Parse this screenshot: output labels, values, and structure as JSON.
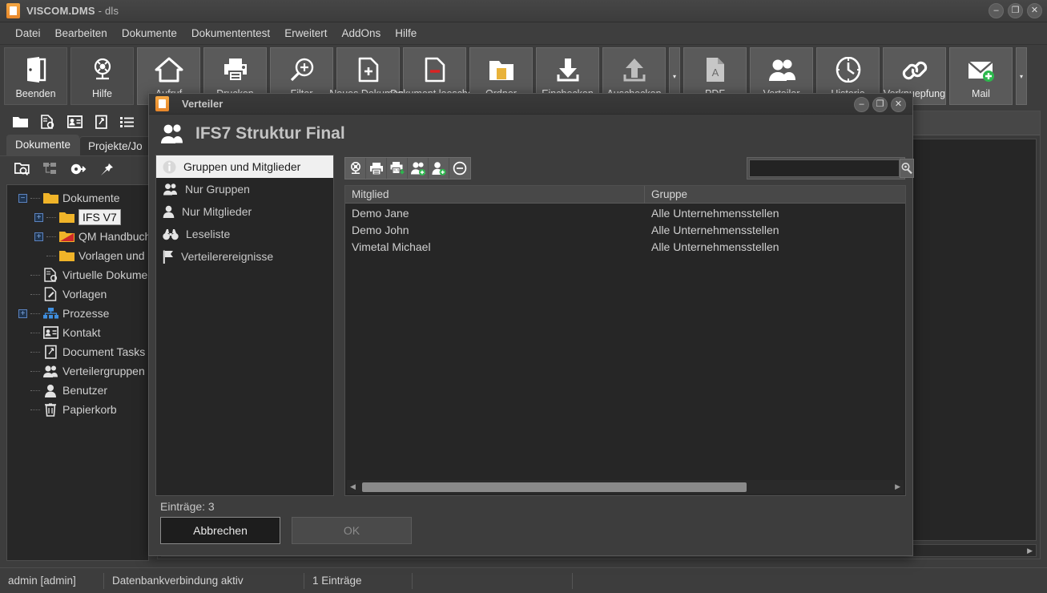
{
  "window": {
    "title": "VISCOM.DMS",
    "title_sub": "- dls",
    "app_icon": "document-icon",
    "controls": [
      {
        "name": "minimize-button",
        "glyph": "–"
      },
      {
        "name": "maximize-button",
        "glyph": "❐"
      },
      {
        "name": "close-button",
        "glyph": "✕"
      }
    ]
  },
  "menubar": {
    "items": [
      "Datei",
      "Bearbeiten",
      "Dokumente",
      "Dokumententest",
      "Erweitert",
      "AddOns",
      "Hilfe"
    ]
  },
  "ribbon": {
    "buttons": [
      {
        "label": "Beenden",
        "icon": "exit-door-icon",
        "dark": true
      },
      {
        "label": "Hilfe",
        "icon": "lifebuoy-icon",
        "dark": true
      },
      {
        "label": "Aufruf",
        "icon": "home-icon",
        "dark": false
      },
      {
        "label": "Drucken",
        "icon": "printer-icon",
        "dark": false
      },
      {
        "label": "Filter",
        "icon": "magnifier-plus-icon",
        "dark": false
      },
      {
        "label": "Neues Dokument",
        "icon": "document-add-icon",
        "dark": false
      },
      {
        "label": "Dokument loeschen",
        "icon": "document-remove-icon",
        "dark": false
      },
      {
        "label": "Ordner",
        "icon": "folder-document-icon",
        "dark": false
      },
      {
        "label": "Einchecken",
        "icon": "download-icon",
        "dark": false
      },
      {
        "label": "Auschecken",
        "icon": "upload-icon",
        "dark": false
      }
    ],
    "dropdown_glyph": "▾",
    "buttons2": [
      {
        "label": "PDF",
        "icon": "pdf-file-icon"
      },
      {
        "label": "Verteiler",
        "icon": "people-icon"
      },
      {
        "label": "Historie",
        "icon": "clock-icon"
      },
      {
        "label": "Verknuepfung",
        "icon": "link-icon"
      },
      {
        "label": "Mail",
        "icon": "mail-add-icon"
      }
    ]
  },
  "sidebar": {
    "toolbar_icons": [
      "folder-icon",
      "document-search-icon",
      "contact-card-icon",
      "clipboard-edit-icon",
      "list-icon"
    ],
    "tabs": [
      {
        "label": "Dokumente",
        "active": true
      },
      {
        "label": "Projekte/Jo",
        "active": false
      }
    ],
    "tree_toolbar_icons": [
      "folder-search-icon",
      "tree-structure-icon",
      "logout-arrow-icon",
      "pin-icon"
    ],
    "tree": [
      {
        "label": "Dokumente",
        "icon": "folder-icon",
        "depth": 0,
        "expander": "minus",
        "selected": false
      },
      {
        "label": "IFS V7",
        "icon": "folder-icon",
        "depth": 1,
        "expander": "plus",
        "selected": true
      },
      {
        "label": "QM Handbuch",
        "icon": "folder-red-icon",
        "depth": 1,
        "expander": "plus",
        "selected": false
      },
      {
        "label": "Vorlagen und",
        "icon": "folder-icon",
        "depth": 1,
        "expander": "none",
        "selected": false
      },
      {
        "label": "Virtuelle Dokume",
        "icon": "document-search-icon",
        "depth": 0,
        "expander": "none",
        "selected": false
      },
      {
        "label": "Vorlagen",
        "icon": "template-icon",
        "depth": 0,
        "expander": "none",
        "selected": false
      },
      {
        "label": "Prozesse",
        "icon": "process-tree-icon",
        "depth": 0,
        "expander": "plus",
        "selected": false
      },
      {
        "label": "Kontakt",
        "icon": "contact-card-icon",
        "depth": 0,
        "expander": "none",
        "selected": false
      },
      {
        "label": "Document Tasks",
        "icon": "clipboard-edit-icon",
        "depth": 0,
        "expander": "none",
        "selected": false
      },
      {
        "label": "Verteilergruppen",
        "icon": "people-icon",
        "depth": 0,
        "expander": "none",
        "selected": false
      },
      {
        "label": "Benutzer",
        "icon": "user-icon",
        "depth": 0,
        "expander": "none",
        "selected": false
      },
      {
        "label": "Papierkorb",
        "icon": "trash-icon",
        "depth": 0,
        "expander": "none",
        "selected": false
      }
    ]
  },
  "statusbar": {
    "user": "admin [admin]",
    "connection": "Datenbankverbindung aktiv",
    "entries": "1 Einträge",
    "extra": ""
  },
  "dialog": {
    "titlebar": {
      "icon": "document-icon",
      "title": "Verteiler",
      "controls": [
        {
          "name": "dialog-minimize-button",
          "glyph": "–"
        },
        {
          "name": "dialog-maximize-button",
          "glyph": "❐"
        },
        {
          "name": "dialog-close-button",
          "glyph": "✕"
        }
      ]
    },
    "header": {
      "icon": "people-icon",
      "title": "IFS7 Struktur Final"
    },
    "nav": [
      {
        "label": "Gruppen und Mitglieder",
        "icon": "info-icon",
        "active": true
      },
      {
        "label": "Nur Gruppen",
        "icon": "people-icon",
        "active": false
      },
      {
        "label": "Nur Mitglieder",
        "icon": "user-icon",
        "active": false
      },
      {
        "label": "Leseliste",
        "icon": "binoculars-icon",
        "active": false
      },
      {
        "label": "Verteilerereignisse",
        "icon": "flag-icon",
        "active": false
      }
    ],
    "toolbar": [
      {
        "name": "lifebuoy-icon",
        "title": "Hilfe"
      },
      {
        "name": "printer-icon",
        "title": "Drucken"
      },
      {
        "name": "export-xls-icon",
        "title": "Export XLS"
      },
      {
        "name": "add-group-icon",
        "title": "Gruppe hinzufügen"
      },
      {
        "name": "add-member-icon",
        "title": "Mitglied hinzufügen"
      },
      {
        "name": "remove-icon",
        "title": "Entfernen"
      }
    ],
    "search": {
      "value": "",
      "placeholder": "",
      "button_icon": "magnifier-icon"
    },
    "grid": {
      "columns": [
        "Mitglied",
        "Gruppe"
      ],
      "rows": [
        [
          "Demo Jane",
          "Alle Unternehmensstellen"
        ],
        [
          "Demo John",
          "Alle Unternehmensstellen"
        ],
        [
          "Vimetal Michael",
          "Alle Unternehmensstellen"
        ]
      ],
      "scroll_left_glyph": "◀",
      "scroll_right_glyph": "▶"
    },
    "footer": {
      "entries_label": "Einträge: 3",
      "cancel_label": "Abbrechen",
      "ok_label": "OK"
    }
  },
  "colors": {
    "accent_orange": "#e8872a",
    "selection": "#f0f0f0",
    "window_bg": "#3d3d3d",
    "panel_bg": "#262626",
    "text": "#cfcfcf",
    "green_badge": "#2db84d"
  }
}
